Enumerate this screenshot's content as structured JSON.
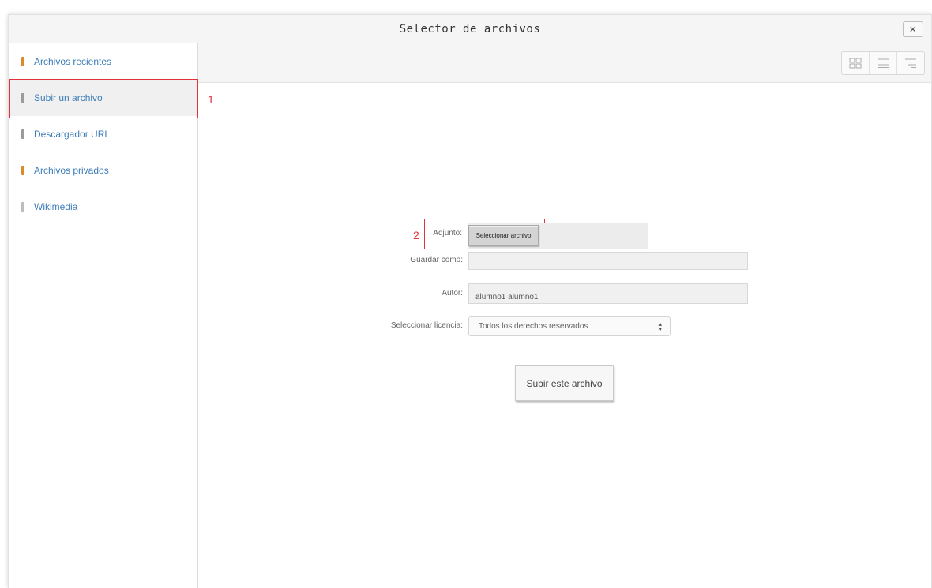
{
  "dialog": {
    "title": "Selector de archivos",
    "close_label": "✕"
  },
  "sidebar": {
    "items": [
      {
        "label": "Archivos recientes",
        "icon": "recent-files-icon",
        "color": "#e0882c"
      },
      {
        "label": "Subir un archivo",
        "icon": "upload-icon",
        "color": "#9b9b9b",
        "active": true
      },
      {
        "label": "Descargador URL",
        "icon": "url-download-icon",
        "color": "#9b9b9b"
      },
      {
        "label": "Archivos privados",
        "icon": "private-files-icon",
        "color": "#e0882c"
      },
      {
        "label": "Wikimedia",
        "icon": "wikimedia-icon",
        "color": "#bdbdbd"
      }
    ]
  },
  "toolbar": {
    "view_buttons": [
      "icons-view-icon",
      "list-view-icon",
      "tree-view-icon"
    ]
  },
  "annotations": {
    "marker_1": "1",
    "marker_2": "2",
    "color": "#e2333a"
  },
  "form": {
    "attachment_label": "Adjunto:",
    "choose_file_label": "Seleccionar archivo",
    "save_as_label": "Guardar como:",
    "save_as_value": "",
    "author_label": "Autor:",
    "author_value": "alumno1 alumno1",
    "license_label": "Seleccionar licencia:",
    "license_value": "Todos los derechos reservados",
    "submit_label": "Subir este archivo"
  }
}
